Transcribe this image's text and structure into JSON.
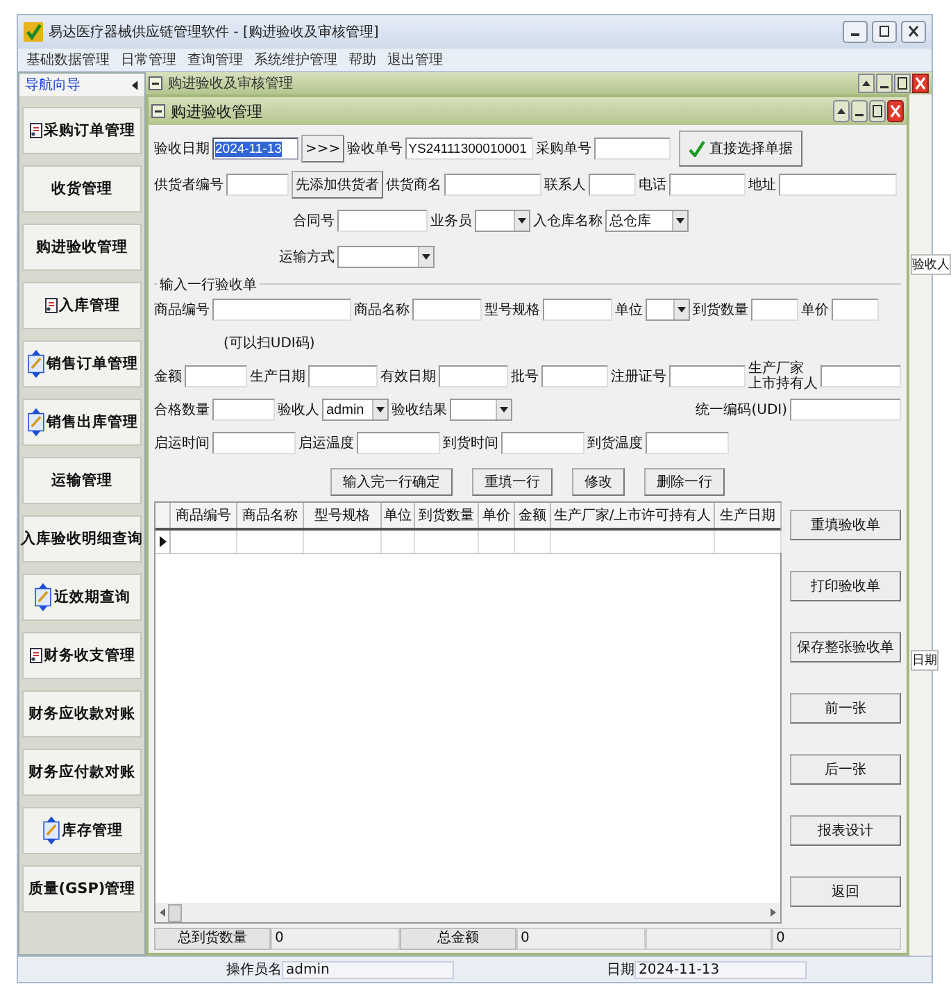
{
  "app_window": {
    "title": "易达医疗器械供应链管理软件 - [购进验收及审核管理]"
  },
  "menu": [
    "基础数据管理",
    "日常管理",
    "查询管理",
    "系统维护管理",
    "帮助",
    "退出管理"
  ],
  "sidebar": {
    "title": "导航向导",
    "items": [
      {
        "label": "采购订单管理",
        "kind": "card"
      },
      {
        "label": "收货管理",
        "kind": "plain"
      },
      {
        "label": "购进验收管理",
        "kind": "plain"
      },
      {
        "label": "入库管理",
        "kind": "card"
      },
      {
        "label": "销售订单管理",
        "kind": "notepad"
      },
      {
        "label": "销售出库管理",
        "kind": "notepad"
      },
      {
        "label": "运输管理",
        "kind": "plain"
      },
      {
        "label": "入库验收明细查询",
        "kind": "plain"
      },
      {
        "label": "近效期查询",
        "kind": "notepad"
      },
      {
        "label": "财务收支管理",
        "kind": "card"
      },
      {
        "label": "财务应收款对账",
        "kind": "plain"
      },
      {
        "label": "财务应付款对账",
        "kind": "plain"
      },
      {
        "label": "库存管理",
        "kind": "notepad"
      },
      {
        "label": "质量(GSP)管理",
        "kind": "plain"
      }
    ]
  },
  "back_window": {
    "title": "购进验收及审核管理",
    "column_headers": [
      "验收人",
      "日期"
    ]
  },
  "form_window": {
    "title": "购进验收管理",
    "header_rows": [
      [
        {
          "kind": "label",
          "text": "验收日期"
        },
        {
          "kind": "input",
          "value": "2024-11-13",
          "highlighted": true
        },
        {
          "kind": "button",
          "text": ">>>"
        },
        {
          "kind": "label",
          "text": "验收单号"
        },
        {
          "kind": "input",
          "value": "YS24111300010001",
          "highlighted": false
        },
        {
          "kind": "label",
          "text": "采购单号"
        },
        {
          "kind": "input"
        },
        {
          "kind": "check_button",
          "text": "直接选择单据"
        }
      ],
      [
        {
          "kind": "label",
          "text": "供货者编号"
        },
        {
          "kind": "input"
        },
        {
          "kind": "button",
          "text": "先添加供货者"
        },
        {
          "kind": "label",
          "text": "供货商名"
        },
        {
          "kind": "input"
        },
        {
          "kind": "label",
          "text": "联系人"
        },
        {
          "kind": "input"
        },
        {
          "kind": "label",
          "text": "电话"
        },
        {
          "kind": "input"
        },
        {
          "kind": "label",
          "text": "地址"
        },
        {
          "kind": "input"
        }
      ],
      [
        {
          "kind": "label",
          "text": "合同号"
        },
        {
          "kind": "input"
        },
        {
          "kind": "label",
          "text": "业务员"
        },
        {
          "kind": "select"
        },
        {
          "kind": "label",
          "text": "入仓库名称"
        },
        {
          "kind": "select",
          "value": "总仓库"
        }
      ],
      [
        {
          "kind": "label",
          "text": "运输方式"
        },
        {
          "kind": "select"
        }
      ]
    ],
    "group": {
      "title": "输入一行验收单",
      "rows": [
        [
          {
            "kind": "label",
            "text": "商品编号"
          },
          {
            "kind": "input"
          },
          {
            "kind": "label",
            "text": "商品名称"
          },
          {
            "kind": "input"
          },
          {
            "kind": "label",
            "text": "型号规格"
          },
          {
            "kind": "input"
          },
          {
            "kind": "label",
            "text": "单位"
          },
          {
            "kind": "select"
          },
          {
            "kind": "label",
            "text": "到货数量"
          },
          {
            "kind": "input"
          },
          {
            "kind": "label",
            "text": "单价"
          },
          {
            "kind": "input"
          }
        ],
        [
          {
            "kind": "note",
            "text": "(可以扫UDI码)"
          }
        ],
        [
          {
            "kind": "label",
            "text": "金额"
          },
          {
            "kind": "input"
          },
          {
            "kind": "label",
            "text": "生产日期"
          },
          {
            "kind": "input"
          },
          {
            "kind": "label",
            "text": "有效日期"
          },
          {
            "kind": "input"
          },
          {
            "kind": "label",
            "text": "批号"
          },
          {
            "kind": "input"
          },
          {
            "kind": "label",
            "text": "注册证号"
          },
          {
            "kind": "input"
          },
          {
            "kind": "label2",
            "lines": [
              "生产厂家",
              "上市持有人"
            ]
          },
          {
            "kind": "input"
          }
        ],
        [
          {
            "kind": "label",
            "text": "合格数量"
          },
          {
            "kind": "input"
          },
          {
            "kind": "label",
            "text": "验收人"
          },
          {
            "kind": "select",
            "value": "admin"
          },
          {
            "kind": "label",
            "text": "验收结果"
          },
          {
            "kind": "select"
          },
          {
            "kind": "label",
            "text": "统一编码(UDI)"
          },
          {
            "kind": "input"
          }
        ],
        [
          {
            "kind": "label",
            "text": "启运时间"
          },
          {
            "kind": "input"
          },
          {
            "kind": "label",
            "text": "启运温度"
          },
          {
            "kind": "input"
          },
          {
            "kind": "label",
            "text": "到货时间"
          },
          {
            "kind": "input"
          },
          {
            "kind": "label",
            "text": "到货温度"
          },
          {
            "kind": "input"
          }
        ]
      ],
      "buttons": [
        "输入完一行确定",
        "重填一行",
        "修改",
        "删除一行"
      ]
    },
    "table": {
      "columns": [
        "商品编号",
        "商品名称",
        "型号规格",
        "单位",
        "到货数量",
        "单价",
        "金额",
        "生产厂家/上市许可持有人",
        "生产日期"
      ],
      "rows": [
        {
          "current": true
        }
      ]
    },
    "side_buttons": [
      "重填验收单",
      "打印验收单",
      "保存整张验收单",
      "前一张",
      "后一张",
      "报表设计",
      "返回"
    ],
    "totals": [
      {
        "kind": "label",
        "text": "总到货数量"
      },
      {
        "kind": "value",
        "text": "0"
      },
      {
        "kind": "label",
        "text": "总金额"
      },
      {
        "kind": "value",
        "text": "0"
      },
      {
        "kind": "blank"
      },
      {
        "kind": "value",
        "text": "0"
      }
    ]
  },
  "status_bar": [
    {
      "kind": "label",
      "text": "操作员名"
    },
    {
      "kind": "value",
      "text": "admin"
    },
    {
      "kind": "label",
      "text": "日期"
    },
    {
      "kind": "value",
      "text": "2024-11-13"
    }
  ]
}
